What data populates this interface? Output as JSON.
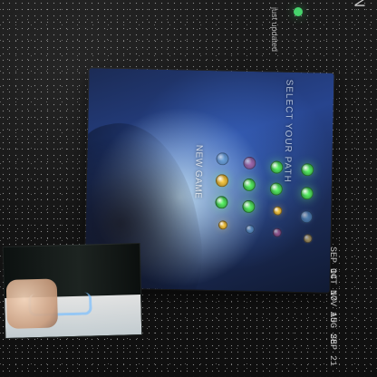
{
  "header": {
    "corner_title": "LONDON",
    "tag_text": "just updated"
  },
  "monitor": {
    "heading": "NEW GAME",
    "banner": "SELECT YOUR PATH"
  },
  "dates": [
    "SEP 14",
    "OCT 17",
    "NOV 15",
    "AUG 28",
    "SEP 21"
  ],
  "colors": {
    "accent_green": "#46d46c",
    "orb_green": "#61ff6b",
    "orb_yellow": "#ffd24a",
    "orb_blue": "#5ab8ff",
    "orb_pink": "#ff66c4"
  }
}
